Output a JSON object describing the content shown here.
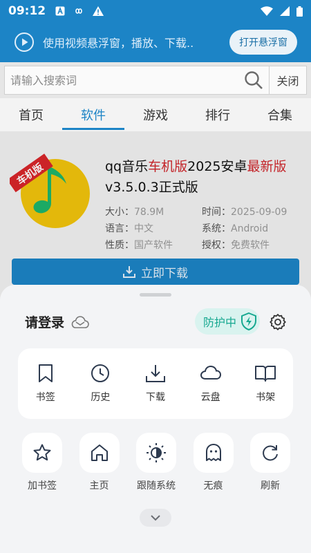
{
  "status_bar": {
    "time": "09:12"
  },
  "banner": {
    "text": "使用视频悬浮窗，播放、下载..",
    "button_label": "打开悬浮窗"
  },
  "search": {
    "placeholder": "请输入搜索词",
    "value": "",
    "close_label": "关闭"
  },
  "tabs": [
    {
      "label": "首页",
      "active": false
    },
    {
      "label": "软件",
      "active": true
    },
    {
      "label": "游戏",
      "active": false
    },
    {
      "label": "排行",
      "active": false
    },
    {
      "label": "合集",
      "active": false
    }
  ],
  "app": {
    "badge": "车机版",
    "title_parts": [
      "qq音乐",
      "车机版",
      "2025安卓",
      "最新版",
      "v3.5.0.3正式版"
    ],
    "size_label": "大小：",
    "size": "78.9M",
    "time_label": "时间：",
    "time": "2025-09-09",
    "lang_label": "语言：",
    "lang": "中文",
    "system_label": "系统：",
    "system": "Android",
    "nature_label": "性质：",
    "nature": "国产软件",
    "license_label": "授权：",
    "license": "免费软件",
    "download_label": "立即下载"
  },
  "sheet": {
    "login_label": "请登录",
    "protect_label": "防护中",
    "tools": [
      "书签",
      "历史",
      "下载",
      "云盘",
      "书架"
    ],
    "actions": [
      "加书签",
      "主页",
      "跟随系统",
      "无痕",
      "刷新"
    ]
  },
  "colors": {
    "accent": "#1c84c6",
    "highlight_red": "#d0272c",
    "protect_green": "#16a890"
  }
}
